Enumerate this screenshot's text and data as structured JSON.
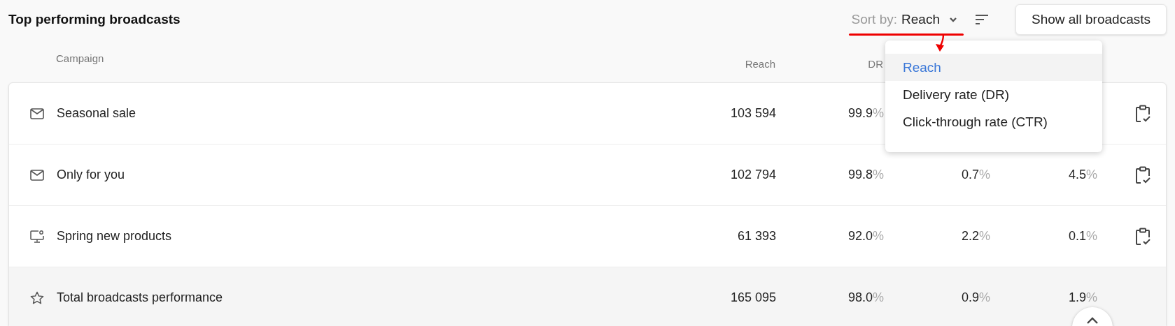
{
  "title": "Top performing broadcasts",
  "sort": {
    "label": "Sort by:",
    "value": "Reach",
    "expanded": true,
    "options": [
      {
        "label": "Reach",
        "selected": true
      },
      {
        "label": "Delivery rate (DR)",
        "selected": false
      },
      {
        "label": "Click-through rate (CTR)",
        "selected": false
      }
    ]
  },
  "show_all_button": "Show all broadcasts",
  "table": {
    "columns": [
      "Campaign",
      "Reach",
      "DR"
    ],
    "rows": [
      {
        "kind": "email",
        "cells": [
          {
            "value": "Seasonal sale"
          },
          {
            "value": "103 594"
          },
          {
            "value": "99.9",
            "unit": "%"
          }
        ]
      },
      {
        "kind": "email",
        "cells": [
          {
            "value": "Only for you"
          },
          {
            "value": "102 794"
          },
          {
            "value": "99.8",
            "unit": "%"
          },
          {
            "value": "0.7",
            "unit": "%"
          },
          {
            "value": "4.5",
            "unit": "%"
          }
        ]
      },
      {
        "kind": "screen",
        "cells": [
          {
            "value": "Spring new products"
          },
          {
            "value": "61 393"
          },
          {
            "value": "92.0",
            "unit": "%"
          },
          {
            "value": "2.2",
            "unit": "%"
          },
          {
            "value": "0.1",
            "unit": "%"
          }
        ]
      },
      {
        "kind": "total",
        "cells": [
          {
            "value": "Total broadcasts performance"
          },
          {
            "value": "165 095"
          },
          {
            "value": "98.0",
            "unit": "%"
          },
          {
            "value": "0.9",
            "unit": "%"
          },
          {
            "value": "1.9",
            "unit": "%"
          }
        ]
      }
    ]
  }
}
